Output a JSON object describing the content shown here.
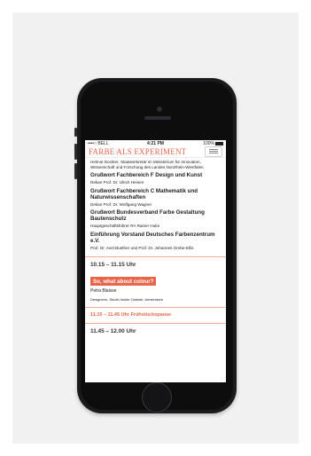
{
  "status_bar": {
    "carrier": "••••○ BELL",
    "time": "4:21 PM",
    "battery": "100%"
  },
  "app": {
    "logo": "FARBE ALS EXPERIMENT"
  },
  "program": {
    "intro": "Helmut Dockter, Staatssekretär im Ministerium für Innovation, Wissenschaft und Forschung des Landes Nordrhein-Westfalen",
    "items": [
      {
        "title": "Grußwort Fachbereich F Design und Kunst",
        "person": "Dekan Prof. Dr. Ulrich Heinen"
      },
      {
        "title": "Grußwort Fachbereich C Mathematik und Naturwissenschaften",
        "person": "Dekan Prof. Dr. Wolfgang Wagner"
      },
      {
        "title": "Grußwort Bundesverband Farbe Gestaltung Bautenschutz",
        "person": "Hauptgeschäftsführer RA Rainer Huke"
      },
      {
        "title": "Einführung Vorstand Deutsches Farbenzentrum e.V.",
        "person": "Prof. Dr. Axel Buether und Prof. Dr. Johannes Grebe-Ellis"
      }
    ],
    "session1": {
      "time": "10.15 – 11.15 Uhr",
      "talk": "So, what about colour?",
      "speaker": "Petra Blaisse",
      "affiliation": "Designerin, Studio Inside Outside, Amsterdam"
    },
    "break": "11.15 – 11.45 Uhr Frühstückspause",
    "session2_time": "11.45 – 12.00 Uhr"
  },
  "colors": {
    "accent": "#e8654a",
    "phone_body": "#1b1b1d"
  }
}
